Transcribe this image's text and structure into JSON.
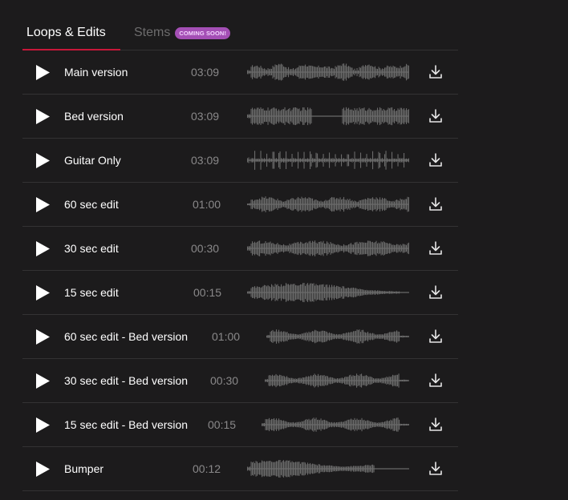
{
  "tabs": {
    "loops_label": "Loops & Edits",
    "stems_label": "Stems",
    "stems_badge": "COMING SOON!"
  },
  "colors": {
    "background": "#1c1b1c",
    "accent": "#c8173a",
    "badge": "#a44fb5",
    "waveform": "#6a6a6a"
  },
  "tracks": [
    {
      "name": "Main version",
      "duration": "03:09"
    },
    {
      "name": "Bed version",
      "duration": "03:09"
    },
    {
      "name": "Guitar Only",
      "duration": "03:09"
    },
    {
      "name": "60 sec edit",
      "duration": "01:00"
    },
    {
      "name": "30 sec edit",
      "duration": "00:30"
    },
    {
      "name": "15 sec edit",
      "duration": "00:15"
    },
    {
      "name": "60 sec edit - Bed version",
      "duration": "01:00"
    },
    {
      "name": "30 sec edit - Bed version",
      "duration": "00:30"
    },
    {
      "name": "15 sec edit - Bed version",
      "duration": "00:15"
    },
    {
      "name": "Bumper",
      "duration": "00:12"
    }
  ],
  "icons": {
    "play": "play-icon",
    "download": "download-icon"
  }
}
